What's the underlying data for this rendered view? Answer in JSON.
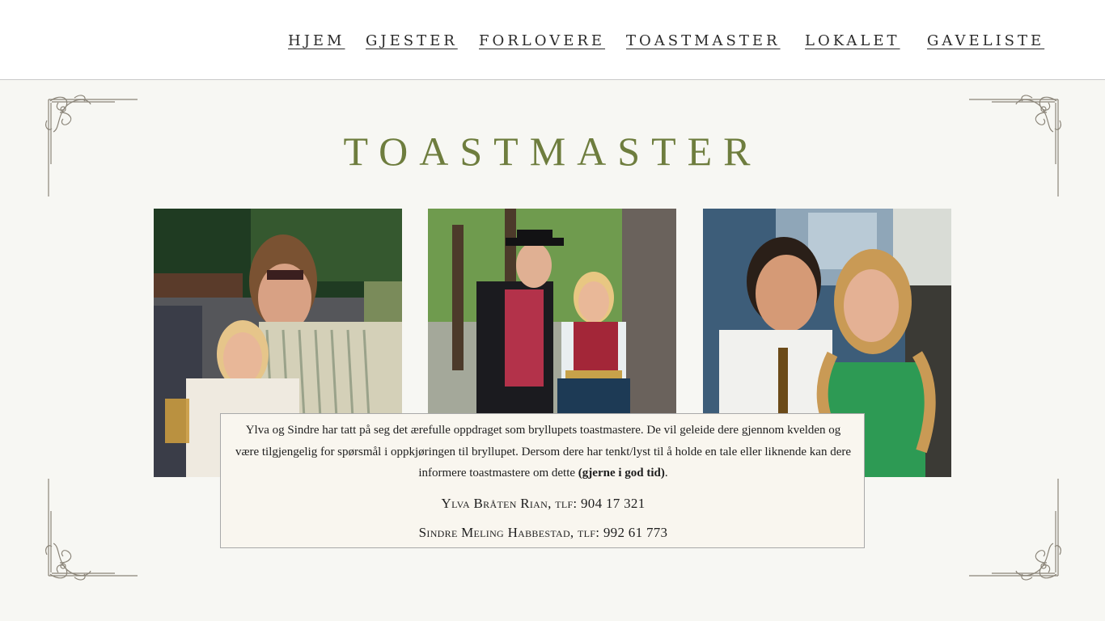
{
  "nav": {
    "items": [
      {
        "label": "HJEM"
      },
      {
        "label": "GJESTER"
      },
      {
        "label": "FORLOVERE"
      },
      {
        "label": "TOASTMASTER"
      },
      {
        "label": "LOKALET"
      },
      {
        "label": "GAVELISTE"
      }
    ]
  },
  "page": {
    "title": "TOASTMASTER"
  },
  "photos": [
    {
      "alt": "Ylva og Sindre på festival"
    },
    {
      "alt": "Ylva og Sindre i bunad"
    },
    {
      "alt": "Ylva og Sindre i pent antrekk"
    }
  ],
  "info": {
    "description": "Ylva og Sindre har tatt på seg det ærefulle oppdraget som bryllupets toastmastere. De vil geleide dere gjennom kvelden og være tilgjengelig for spørsmål i oppkjøringen til bryllupet. Dersom dere har tenkt/lyst til å holde en tale eller liknende kan dere informere toastmastere om dette ",
    "description_bold": "(gjerne i god tid)",
    "description_end": ".",
    "contacts": [
      {
        "text": "Ylva Bråten Rian, tlf: 904 17 321"
      },
      {
        "text": "Sindre Meling Habbestad, tlf: 992 61 773"
      }
    ]
  },
  "colors": {
    "title": "#6e7d3e",
    "background": "#f7f7f3",
    "infobox_bg": "#f9f6ef"
  },
  "icons": [
    "ornament-corner-top-left",
    "ornament-corner-top-right",
    "ornament-corner-bottom-left",
    "ornament-corner-bottom-right"
  ]
}
